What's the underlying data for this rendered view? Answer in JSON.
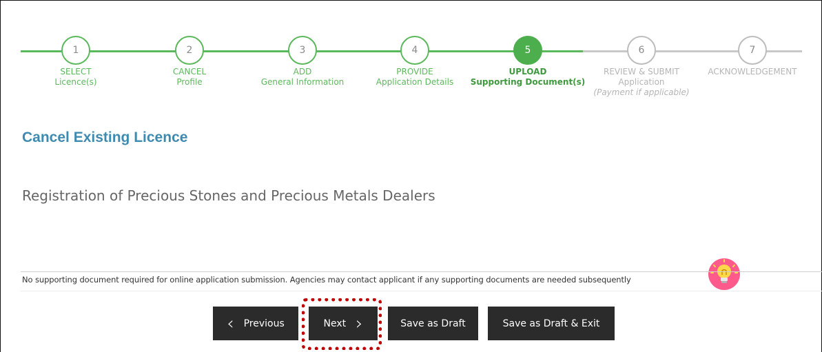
{
  "stepper": {
    "steps": [
      {
        "number": "1",
        "line1": "SELECT",
        "line2": "Licence(s)",
        "line3": "",
        "state": "done"
      },
      {
        "number": "2",
        "line1": "CANCEL",
        "line2": "Profile",
        "line3": "",
        "state": "done"
      },
      {
        "number": "3",
        "line1": "ADD",
        "line2": "General Information",
        "line3": "",
        "state": "done"
      },
      {
        "number": "4",
        "line1": "PROVIDE",
        "line2": "Application Details",
        "line3": "",
        "state": "done"
      },
      {
        "number": "5",
        "line1": "UPLOAD",
        "line2": "Supporting Document(s)",
        "line3": "",
        "state": "current"
      },
      {
        "number": "6",
        "line1": "REVIEW & SUBMIT",
        "line2": "Application",
        "line3": "(Payment if applicable)",
        "state": "todo"
      },
      {
        "number": "7",
        "line1": "ACKNOWLEDGEMENT",
        "line2": "",
        "line3": "",
        "state": "todo"
      }
    ]
  },
  "page": {
    "title": "Cancel Existing Licence",
    "subtitle": "Registration of Precious Stones and Precious Metals Dealers",
    "notice": "No supporting document required for online application submission. Agencies may contact applicant if any supporting documents are needed subsequently"
  },
  "buttons": {
    "previous": "Previous",
    "next": "Next",
    "save_draft": "Save as Draft",
    "save_draft_exit": "Save as Draft & Exit"
  },
  "icons": {
    "bulb": "lightbulb-icon",
    "prev": "chevron-left-icon",
    "next": "chevron-right-icon"
  },
  "colors": {
    "done_green": "#5cb85c",
    "current_green": "#4cae4c",
    "todo_grey": "#bdbdbd",
    "title_blue": "#3f8bb0",
    "button_dark": "#2b2b2b",
    "highlight_red": "#c00000",
    "bulb_pink": "#ff5a8c",
    "bulb_yellow": "#ffd84a"
  }
}
